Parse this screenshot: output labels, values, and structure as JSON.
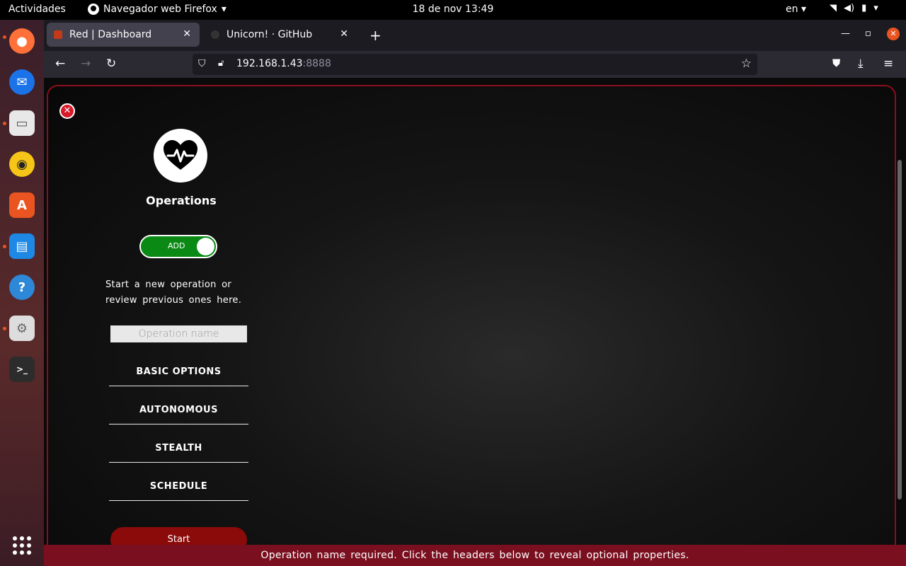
{
  "topbar": {
    "activities": "Actividades",
    "app_menu": "Navegador web Firefox",
    "clock": "18 de nov  13:49",
    "language": "en"
  },
  "browser": {
    "tabs": [
      {
        "label": "Red | Dashboard",
        "active": true
      },
      {
        "label": "Unicorn! · GitHub",
        "active": false
      }
    ],
    "url_host": "192.168.1.43",
    "url_port": ":8888"
  },
  "page": {
    "title": "Operations",
    "toggle_label": "ADD",
    "description": "Start a new operation or review previous ones here.",
    "operation_name_placeholder": "Operation name",
    "sections": [
      "BASIC OPTIONS",
      "AUTONOMOUS",
      "STEALTH",
      "SCHEDULE"
    ],
    "start_label": "Start",
    "status_message": "Operation name required. Click the headers below to reveal optional properties."
  },
  "colors": {
    "accent_red": "#8b0e1c",
    "toggle_green": "#0a8a14",
    "status_bar": "#7a0f1f",
    "start_button": "#8b0a0a"
  },
  "icons": {
    "logo": "heart-pulse-icon",
    "close": "close-circle-icon"
  }
}
